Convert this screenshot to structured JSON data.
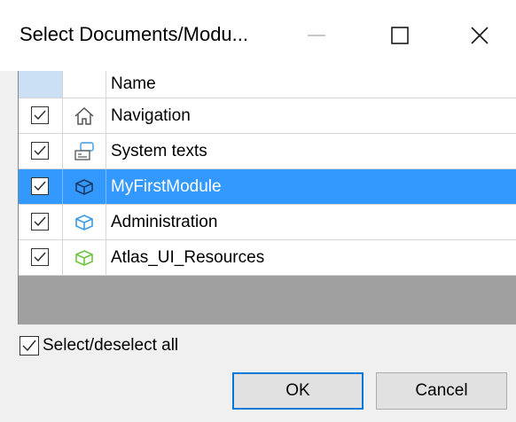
{
  "dialog": {
    "title": "Select Documents/Modu...",
    "minimize_label": "—",
    "maximize_label": "☐",
    "close_label": "✕"
  },
  "grid": {
    "header": {
      "name_label": "Name"
    },
    "rows": [
      {
        "name": "Navigation",
        "checked": true,
        "icon": "home-icon",
        "icon_color": "#555555",
        "selected": false
      },
      {
        "name": "System texts",
        "checked": true,
        "icon": "system-texts-icon",
        "icon_color": "#3c9be8",
        "selected": false
      },
      {
        "name": "MyFirstModule",
        "checked": true,
        "icon": "module-box-icon",
        "icon_color": "#1a3a66",
        "selected": true
      },
      {
        "name": "Administration",
        "checked": true,
        "icon": "module-box-icon",
        "icon_color": "#3c9be8",
        "selected": false
      },
      {
        "name": "Atlas_UI_Resources",
        "checked": true,
        "icon": "module-box-icon",
        "icon_color": "#6cc63f",
        "selected": false
      }
    ]
  },
  "select_all": {
    "label": "Select/deselect all",
    "checked": true
  },
  "buttons": {
    "ok_label": "OK",
    "cancel_label": "Cancel"
  },
  "colors": {
    "selection": "#3399ff",
    "grid_empty": "#a0a0a0",
    "header_check_bg": "#cce0f5"
  }
}
